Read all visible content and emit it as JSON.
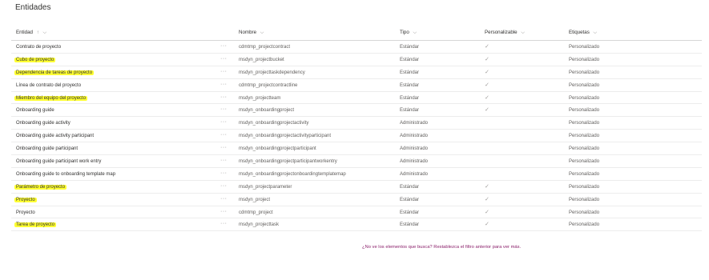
{
  "page": {
    "title": "Entidades"
  },
  "table": {
    "columns": {
      "entidad": "Entidad",
      "entidad_sort": "↑",
      "nombre": "Nombre",
      "tipo": "Tipo",
      "personalizable": "Personalizable",
      "etiquetas": "Etiquetas"
    },
    "rows": [
      {
        "entidad": "Contrato de proyecto",
        "nombre": "cdmtmp_projectcontract",
        "tipo": "Estándar",
        "personalizable": true,
        "etiquetas": "Personalizado",
        "highlighted": false
      },
      {
        "entidad": "Cubo de proyecto",
        "nombre": "msdyn_projectbucket",
        "tipo": "Estándar",
        "personalizable": true,
        "etiquetas": "Personalizado",
        "highlighted": true
      },
      {
        "entidad": "Dependencia de tareas de proyecto",
        "nombre": "msdyn_projecttaskdependency",
        "tipo": "Estándar",
        "personalizable": true,
        "etiquetas": "Personalizado",
        "highlighted": true
      },
      {
        "entidad": "Línea de contrato del proyecto",
        "nombre": "cdmtmp_projectcontractline",
        "tipo": "Estándar",
        "personalizable": true,
        "etiquetas": "Personalizado",
        "highlighted": false
      },
      {
        "entidad": "Miembro del equipo del proyecto",
        "nombre": "msdyn_projectteam",
        "tipo": "Estándar",
        "personalizable": true,
        "etiquetas": "Personalizado",
        "highlighted": true
      },
      {
        "entidad": "Onboarding guide",
        "nombre": "msdyn_onboardingproject",
        "tipo": "Estándar",
        "personalizable": true,
        "etiquetas": "Personalizado",
        "highlighted": false
      },
      {
        "entidad": "Onboarding guide activity",
        "nombre": "msdyn_onboardingprojectactivity",
        "tipo": "Administrado",
        "personalizable": false,
        "etiquetas": "Personalizado",
        "highlighted": false
      },
      {
        "entidad": "Onboarding guide activity participant",
        "nombre": "msdyn_onboardingprojectactivityparticipant",
        "tipo": "Administrado",
        "personalizable": false,
        "etiquetas": "Personalizado",
        "highlighted": false
      },
      {
        "entidad": "Onboarding guide participant",
        "nombre": "msdyn_onboardingprojectparticipant",
        "tipo": "Administrado",
        "personalizable": false,
        "etiquetas": "Personalizado",
        "highlighted": false
      },
      {
        "entidad": "Onboarding guide participant work entry",
        "nombre": "msdyn_onboardingprojectparticipantworkentry",
        "tipo": "Administrado",
        "personalizable": false,
        "etiquetas": "Personalizado",
        "highlighted": false
      },
      {
        "entidad": "Onboarding guide to onboarding template map",
        "nombre": "msdyn_onboardingprojectonboardingtemplatemap",
        "tipo": "Administrado",
        "personalizable": false,
        "etiquetas": "Personalizado",
        "highlighted": false
      },
      {
        "entidad": "Parámetro de proyecto",
        "nombre": "msdyn_projectparameter",
        "tipo": "Estándar",
        "personalizable": true,
        "etiquetas": "Personalizado",
        "highlighted": true
      },
      {
        "entidad": "Proyecto",
        "nombre": "msdyn_project",
        "tipo": "Estándar",
        "personalizable": true,
        "etiquetas": "Personalizado",
        "highlighted": true
      },
      {
        "entidad": "Proyecto",
        "nombre": "cdmtmp_project",
        "tipo": "Estándar",
        "personalizable": true,
        "etiquetas": "Personalizado",
        "highlighted": false
      },
      {
        "entidad": "Tarea de proyecto",
        "nombre": "msdyn_projecttask",
        "tipo": "Estándar",
        "personalizable": true,
        "etiquetas": "Personalizado",
        "highlighted": true
      }
    ],
    "more_glyph": "···",
    "check_glyph": "✓"
  },
  "footer": {
    "message": "¿No ve los elementos que busca? Restablezca el filtro anterior para ver más."
  },
  "colors": {
    "highlight": "#ffff33",
    "link": "#8a1f6a",
    "check": "#a19f9d"
  },
  "icons": {
    "sort": "arrow-up-icon",
    "column_menu": "chevron-down-icon",
    "row_menu": "more-options-icon",
    "check": "checkmark-icon"
  }
}
